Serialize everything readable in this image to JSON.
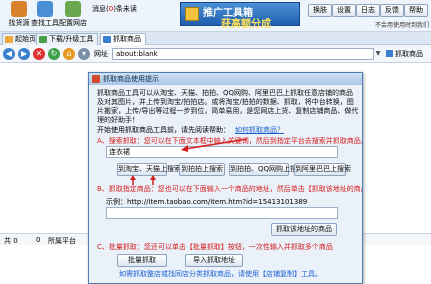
{
  "toolbar": {
    "tools": [
      {
        "label": "找货源",
        "color": "#d9822b"
      },
      {
        "label": "查找工具",
        "color": "#4a8fd4"
      },
      {
        "label": "配置网店",
        "color": "#6aa84f"
      }
    ],
    "message_label": "消息(",
    "message_count": "0",
    "message_suffix": ")条未读",
    "banner_line1": "推广工具箱",
    "banner_line2": "获高额分成",
    "buttons": [
      "换肤",
      "设置",
      "日志",
      "反馈",
      "帮助"
    ],
    "hint": "不会用使用时到我们"
  },
  "tabs": [
    {
      "label": "起始页"
    },
    {
      "label": "下载/升级工具"
    },
    {
      "label": "抓取商品"
    }
  ],
  "nav": {
    "label": "网址",
    "url": "about:blank",
    "go_label": "抓取商品"
  },
  "statusbar": {
    "left": "共 0",
    "mid": "0",
    "platform_label": "所属平台"
  },
  "dialog": {
    "title": "抓取商品使用提示",
    "intro": "抓取商品工具可以从淘宝、天猫、拍拍、QQ网购、阿里巴巴上抓取任意店铺的商品及对其图片，并上传到淘宝/拍拍店。或将淘宝/拍拍的数据、抓取，将中台转换，图片搬家，上传/导出等过程一步到位，简单易用，是您网店上货、复制店铺商品、做代理的好助手！",
    "help_prompt": "开始使用抓取商品工具前，请先阅读帮助：",
    "help_link": "如何抓取商品？",
    "step_a": "A、搜索抓取：您可以在下面文本框中输入关键词，然后到指定平台去搜索并抓取商品。示例：连衣裙",
    "keyword_value": "连衣裙",
    "search_buttons": [
      "到淘宝、天猫上搜索",
      "到拍拍上搜索",
      "到拍拍、QQ网购上搜索",
      "到阿里巴巴上搜索"
    ],
    "step_b": "B、抓取指定商品：您也可以在下面输入一个商品的地址，然后单击【抓取该地址的商品】",
    "example": "示例：http://item.taobao.com/item.htm?id=15413101389",
    "link_value": "",
    "fetch_button": "抓取该地址的商品",
    "step_c": "C、批量抓取：您还可以单击【批量抓取】按钮，一次性输入并抓取多个商品",
    "batch_buttons": [
      "批量抓取",
      "导入抓取地址"
    ],
    "footer_note": "如需抓取整店或找同店分类抓取商品，请使用【店铺复制】工具。"
  }
}
